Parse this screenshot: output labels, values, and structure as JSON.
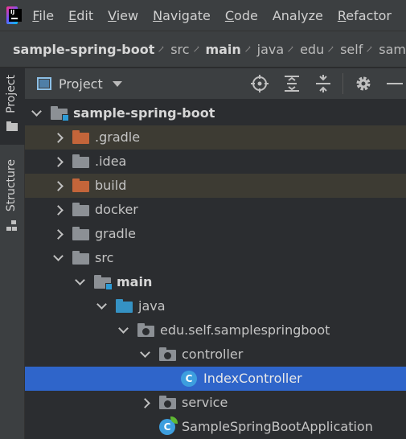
{
  "menubar": {
    "items": [
      "File",
      "Edit",
      "View",
      "Navigate",
      "Code",
      "Analyze",
      "Refactor"
    ],
    "mnemonics": [
      "F",
      "E",
      "V",
      "N",
      "C",
      "",
      "R"
    ]
  },
  "breadcrumbs": {
    "items": [
      {
        "label": "sample-spring-boot",
        "bold": true
      },
      {
        "label": "src",
        "bold": false
      },
      {
        "label": "main",
        "bold": true
      },
      {
        "label": "java",
        "bold": false
      },
      {
        "label": "edu",
        "bold": false
      },
      {
        "label": "self",
        "bold": false
      },
      {
        "label": "sam",
        "bold": false
      }
    ]
  },
  "toolstrip": {
    "project_tab": "Project",
    "structure_tab": "Structure"
  },
  "project_panel": {
    "title": "Project",
    "buttons": [
      "locate-icon",
      "expand-all-icon",
      "collapse-all-icon",
      "settings-icon",
      "hide-icon"
    ]
  },
  "tree": [
    {
      "label": "sample-spring-boot",
      "indent": 0,
      "arrow": "down",
      "icon": "module-folder",
      "bold": true,
      "state": "normal"
    },
    {
      "label": ".gradle",
      "indent": 1,
      "arrow": "right",
      "icon": "folder-orange",
      "bold": false,
      "state": "excluded"
    },
    {
      "label": ".idea",
      "indent": 1,
      "arrow": "right",
      "icon": "folder-gray",
      "bold": false,
      "state": "normal"
    },
    {
      "label": "build",
      "indent": 1,
      "arrow": "right",
      "icon": "folder-orange",
      "bold": false,
      "state": "excluded"
    },
    {
      "label": "docker",
      "indent": 1,
      "arrow": "right",
      "icon": "folder-gray",
      "bold": false,
      "state": "normal"
    },
    {
      "label": "gradle",
      "indent": 1,
      "arrow": "right",
      "icon": "folder-gray",
      "bold": false,
      "state": "normal"
    },
    {
      "label": "src",
      "indent": 1,
      "arrow": "down",
      "icon": "folder-gray",
      "bold": false,
      "state": "normal"
    },
    {
      "label": "main",
      "indent": 2,
      "arrow": "down",
      "icon": "module-folder",
      "bold": true,
      "state": "normal"
    },
    {
      "label": "java",
      "indent": 3,
      "arrow": "down",
      "icon": "folder-blue",
      "bold": false,
      "state": "normal"
    },
    {
      "label": "edu.self.samplespringboot",
      "indent": 4,
      "arrow": "down",
      "icon": "package",
      "bold": false,
      "state": "normal"
    },
    {
      "label": "controller",
      "indent": 5,
      "arrow": "down",
      "icon": "package",
      "bold": false,
      "state": "normal"
    },
    {
      "label": "IndexController",
      "indent": 6,
      "arrow": "none",
      "icon": "class",
      "bold": false,
      "state": "selected"
    },
    {
      "label": "service",
      "indent": 5,
      "arrow": "right",
      "icon": "package",
      "bold": false,
      "state": "normal"
    },
    {
      "label": "SampleSpringBootApplication",
      "indent": 5,
      "arrow": "none",
      "icon": "spring-class",
      "bold": false,
      "state": "normal"
    }
  ],
  "colors": {
    "selection": "#2f65ca",
    "excluded_row": "#3d3b33",
    "folder_excluded": "#c3653a",
    "folder_source": "#3592c4",
    "folder_plain": "#8c9095"
  }
}
